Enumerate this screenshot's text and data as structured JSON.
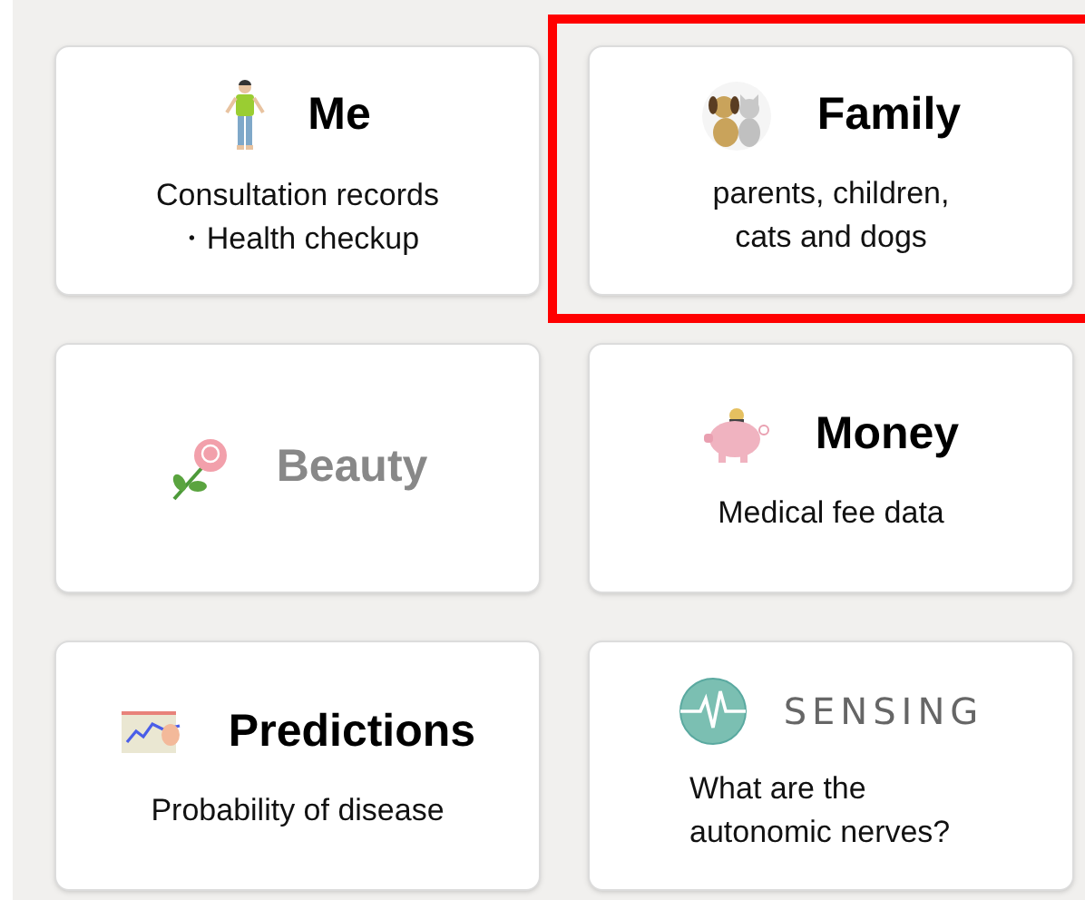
{
  "cards": [
    {
      "title": "Me",
      "kind": "text",
      "disabled": false,
      "highlighted": false,
      "subtitle_lines": [
        "Consultation records",
        "・Health checkup"
      ]
    },
    {
      "title": "Family",
      "kind": "text",
      "disabled": false,
      "highlighted": true,
      "subtitle_lines": [
        "parents, children,",
        "cats and dogs"
      ]
    },
    {
      "title": "Beauty",
      "kind": "text",
      "disabled": true,
      "highlighted": false
    },
    {
      "title": "Money",
      "kind": "text",
      "disabled": false,
      "highlighted": false,
      "subtitle_lines": [
        "Medical fee data"
      ]
    },
    {
      "title": "Predictions",
      "kind": "text",
      "disabled": false,
      "highlighted": false,
      "subtitle_lines": [
        "Probability of disease"
      ]
    },
    {
      "title": "SENSING",
      "kind": "logo",
      "disabled": false,
      "highlighted": false,
      "subtitle_lines": [
        "What are the",
        "autonomic nerves?"
      ]
    }
  ]
}
